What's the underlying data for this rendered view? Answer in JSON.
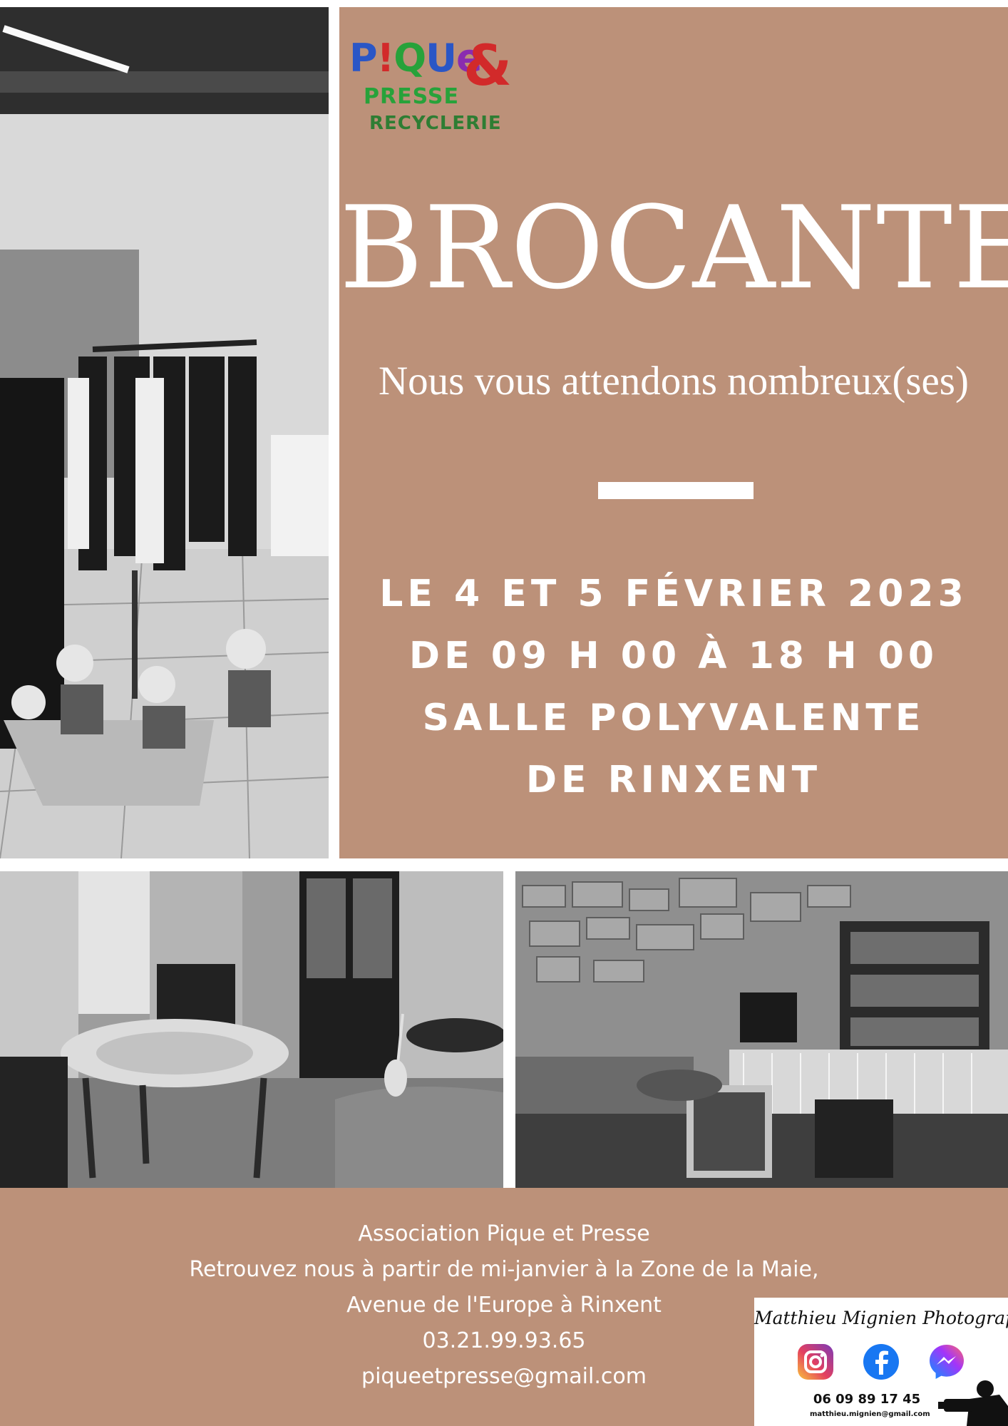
{
  "logo": {
    "line1_letters": [
      "P",
      "!",
      "Q",
      "U",
      "e"
    ],
    "line1_colors": [
      "#2a56c6",
      "#d22a2a",
      "#27a23a",
      "#2a56c6",
      "#8a2cb0"
    ],
    "ampersand": "&",
    "line2": "PRESSE",
    "line3": "RECYCLERIE"
  },
  "event": {
    "title": "BROCANTE",
    "subtitle": "Nous vous attendons nombreux(ses)",
    "date": "LE 4 ET 5 FÉVRIER 2023",
    "hours": "DE 09 H 00 À 18 H 00",
    "venue_line1": "SALLE POLYVALENTE",
    "venue_line2": "DE RINXENT"
  },
  "footer": {
    "association": "Association Pique et Presse",
    "location_line1": "Retrouvez nous à partir de mi-janvier à la Zone de la Maie,",
    "location_line2": "Avenue de l'Europe à Rinxent",
    "phone": "03.21.99.93.65",
    "email": "piqueetpresse@gmail.com"
  },
  "photographer_card": {
    "name": "Matthieu Mignien Photographie",
    "phone": "06 09 89 17 45",
    "email": "matthieu.mignien@gmail.com",
    "icons": [
      "instagram-icon",
      "facebook-icon",
      "messenger-icon"
    ]
  },
  "colors": {
    "panel_background": "#bc9179",
    "text": "#ffffff"
  }
}
